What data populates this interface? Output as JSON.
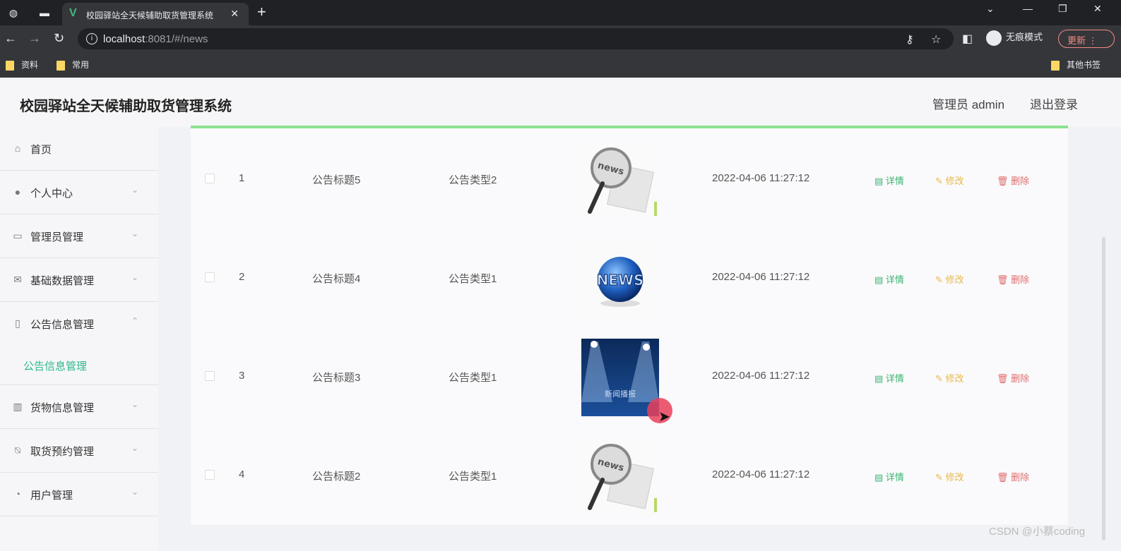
{
  "browser": {
    "tab_title": "校园驿站全天候辅助取货管理系统",
    "url_host": "localhost",
    "url_path": ":8081/#/news",
    "incognito_label": "无痕模式",
    "update_label": "更新",
    "bookmarks": [
      "资料",
      "常用"
    ],
    "other_bookmarks": "其他书签"
  },
  "header": {
    "title": "校园驿站全天候辅助取货管理系统",
    "user": "管理员 admin",
    "logout": "退出登录"
  },
  "sidebar": {
    "items": [
      {
        "label": "首页",
        "icon": "home-icon"
      },
      {
        "label": "个人中心",
        "icon": "user-icon"
      },
      {
        "label": "管理员管理",
        "icon": "chat-icon"
      },
      {
        "label": "基础数据管理",
        "icon": "mail-icon"
      },
      {
        "label": "公告信息管理",
        "icon": "microphone-icon"
      },
      {
        "label": "货物信息管理",
        "icon": "box-icon"
      },
      {
        "label": "取货预约管理",
        "icon": "bell-off-icon"
      },
      {
        "label": "用户管理",
        "icon": "compass-icon"
      }
    ],
    "sub_item": "公告信息管理"
  },
  "table": {
    "rows": [
      {
        "index": "1",
        "title": "公告标题5",
        "type": "公告类型2",
        "image": "news-magnifier",
        "time": "2022-04-06 11:27:12"
      },
      {
        "index": "2",
        "title": "公告标题4",
        "type": "公告类型1",
        "image": "news-globe",
        "time": "2022-04-06 11:27:12"
      },
      {
        "index": "3",
        "title": "公告标题3",
        "type": "公告类型1",
        "image": "news-stage",
        "time": "2022-04-06 11:27:12"
      },
      {
        "index": "4",
        "title": "公告标题2",
        "type": "公告类型1",
        "image": "news-magnifier",
        "time": "2022-04-06 11:27:12"
      }
    ],
    "actions": {
      "detail": "详情",
      "edit": "修改",
      "delete": "删除"
    },
    "stage_image_text": "新闻播报"
  },
  "watermark": "CSDN @小蔡coding"
}
